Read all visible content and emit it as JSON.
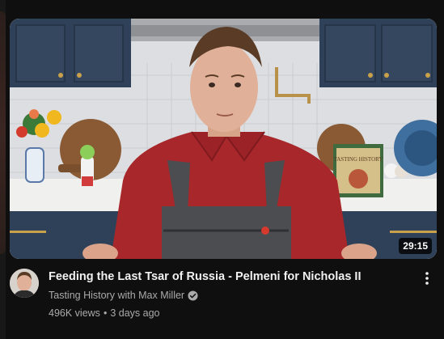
{
  "video": {
    "duration": "29:15",
    "title": "Feeding the Last Tsar of Russia - Pelmeni for Nicholas II",
    "channel": "Tasting History with Max Miller",
    "views": "496K views",
    "separator": "•",
    "age": "3 days ago",
    "book_cover_text": "TASTING HISTORY"
  },
  "icons": {
    "verified": "verified-check-icon",
    "more": "more-vert-icon"
  },
  "colors": {
    "background": "#0f0f0f",
    "title": "#f1f1f1",
    "secondary_text": "#aaaaaa",
    "shirt": "#a8272b",
    "apron": "#4b4d50",
    "cabinets": "#2f4158"
  }
}
